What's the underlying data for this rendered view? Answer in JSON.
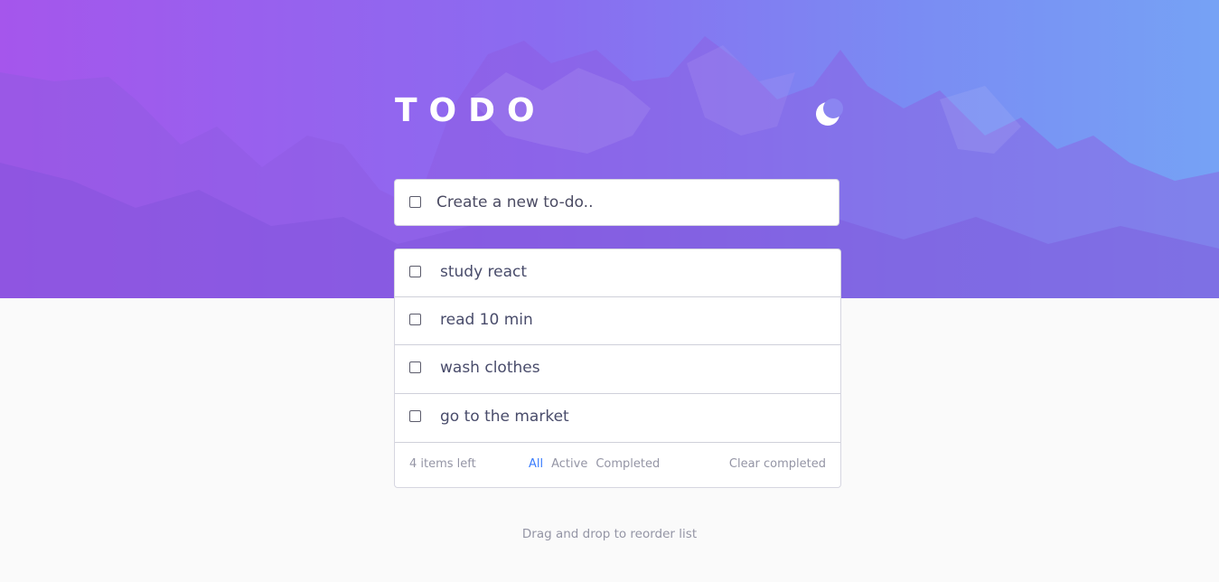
{
  "app": {
    "title": "TODO",
    "theme_toggle_icon": "moon-icon"
  },
  "new_todo": {
    "placeholder": "Create a new to-do.."
  },
  "todos": [
    {
      "text": "study react",
      "completed": false
    },
    {
      "text": "read 10 min",
      "completed": false
    },
    {
      "text": "wash clothes",
      "completed": false
    },
    {
      "text": "go to the market",
      "completed": false
    }
  ],
  "footer": {
    "items_left": "4 items left",
    "filters": [
      "All",
      "Active",
      "Completed"
    ],
    "active_filter": "All",
    "clear_label": "Clear completed"
  },
  "hint": "Drag and drop to reorder list",
  "colors": {
    "accent": "#3a7cfd",
    "hero_gradient_start": "#a556ec",
    "hero_gradient_end": "#76a2f5",
    "text": "#494c6b",
    "muted": "#9495a5"
  }
}
